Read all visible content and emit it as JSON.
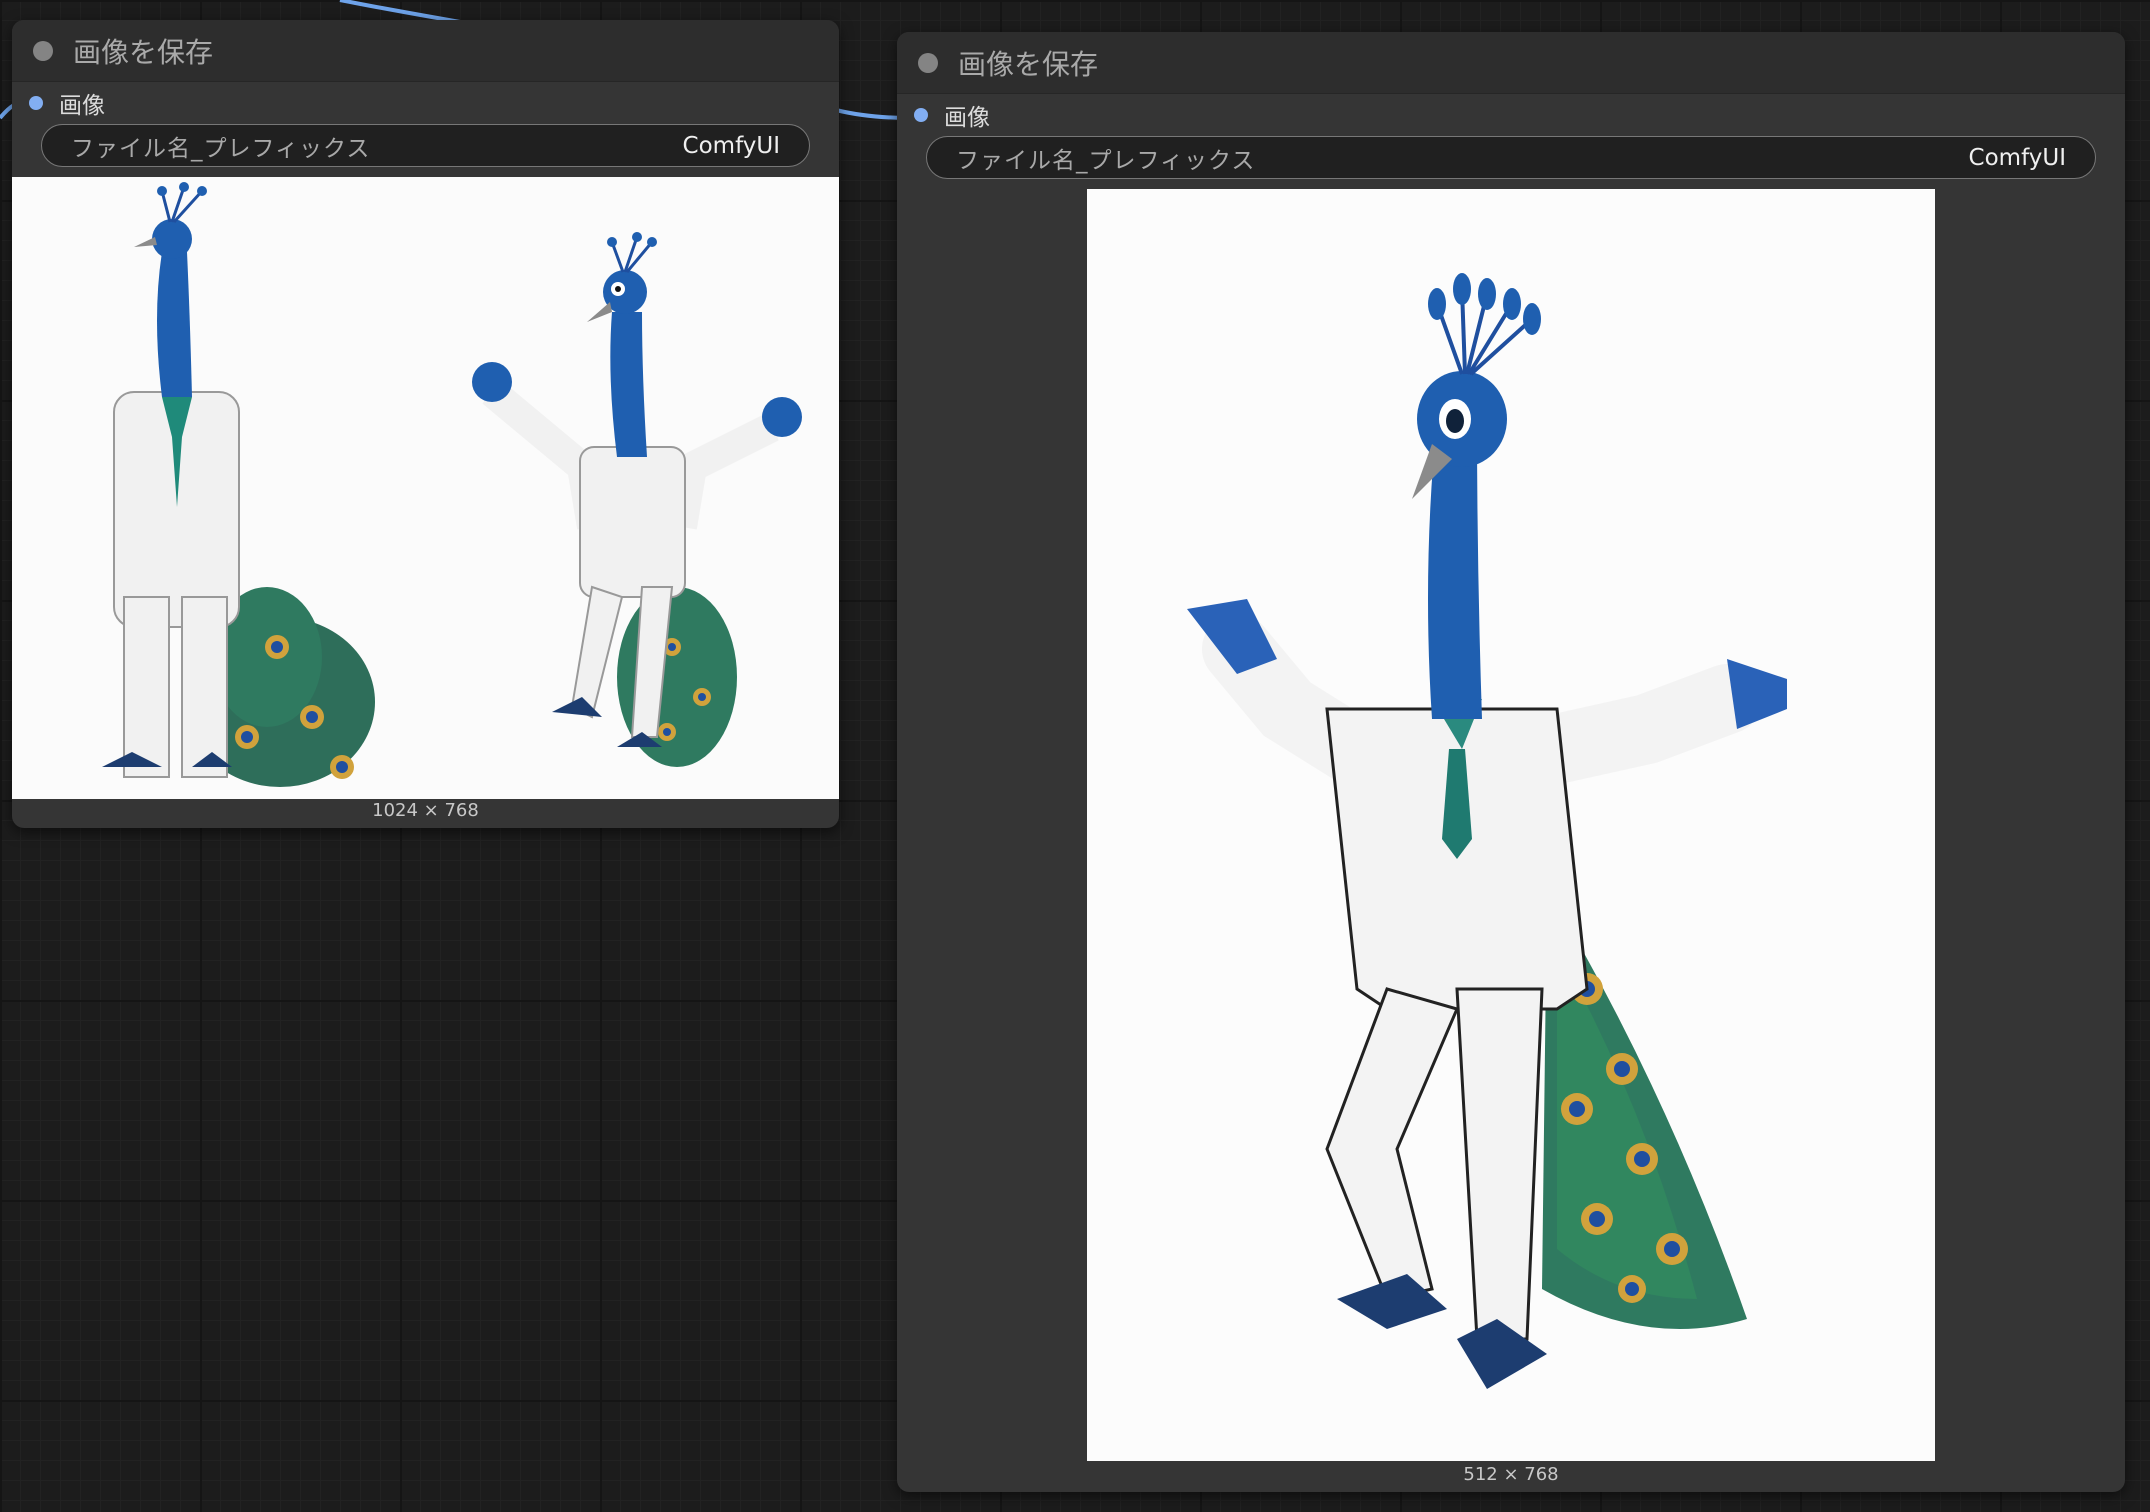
{
  "nodes": [
    {
      "title": "画像を保存",
      "input_label": "画像",
      "widget": {
        "name": "ファイル名_プレフィックス",
        "value": "ComfyUI"
      },
      "image_dims": "1024 × 768"
    },
    {
      "title": "画像を保存",
      "input_label": "画像",
      "widget": {
        "name": "ファイル名_プレフィックス",
        "value": "ComfyUI"
      },
      "image_dims": "512 × 768"
    }
  ],
  "colors": {
    "canvas": "#1c1c1c",
    "node_body": "#353535",
    "node_header": "#2d2d2d",
    "link": "#6ea3ea",
    "input_slot": "#82aef2"
  }
}
